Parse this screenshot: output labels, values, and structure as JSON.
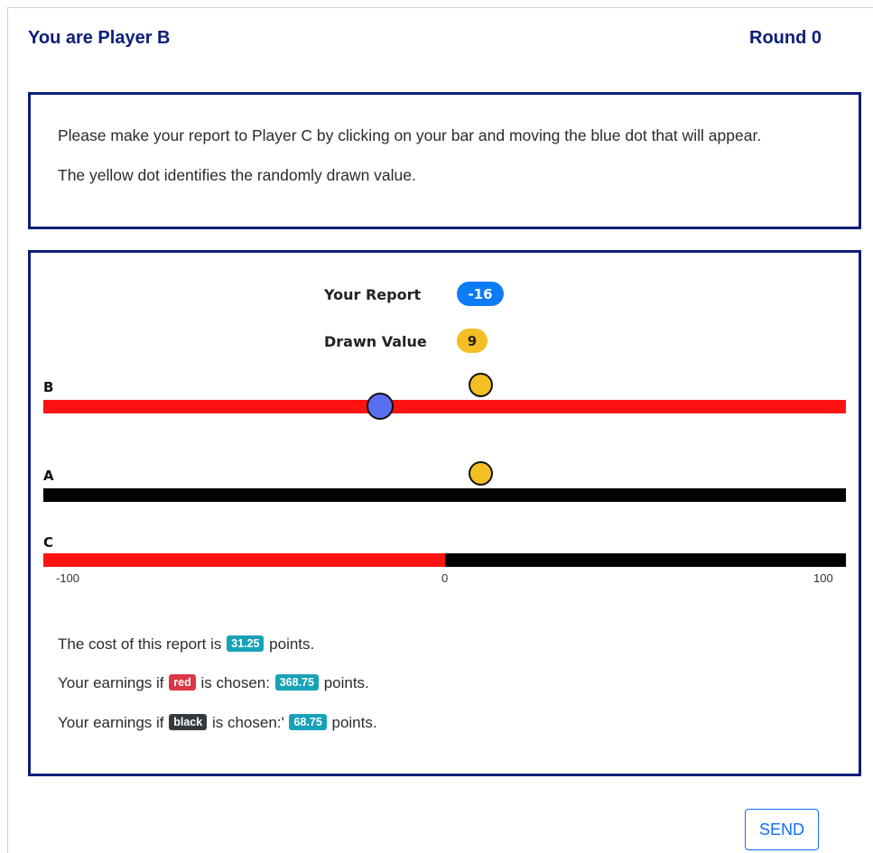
{
  "header": {
    "player": "You are Player B",
    "round": "Round 0"
  },
  "instructions": {
    "line1": "Please make your report to Player C by clicking on your bar and moving the blue dot that will appear.",
    "line2": "The yellow dot identifies the randomly drawn value."
  },
  "report": {
    "label": "Your Report",
    "value": "-16"
  },
  "drawn": {
    "label": "Drawn Value",
    "value": "9"
  },
  "bars": {
    "b_label": "B",
    "a_label": "A",
    "c_label": "C",
    "scale_min": -100,
    "scale_max": 100,
    "report_value": -16,
    "drawn_value": 9,
    "c_split_value": 0,
    "ticks": [
      "-100",
      "0",
      "100"
    ]
  },
  "colors": {
    "red": "#ff1212",
    "black": "#000000",
    "report_dot": "#5a6ff0",
    "drawn_dot": "#f4bf24"
  },
  "earnings": {
    "cost_prefix": "The cost of this report is",
    "cost_value": "31.25",
    "cost_suffix": "points.",
    "red_prefix": "Your earnings if",
    "red_tag": "red",
    "red_middle": "is chosen:",
    "red_value": "368.75",
    "red_suffix": "points.",
    "black_prefix": "Your earnings if",
    "black_tag": "black",
    "black_middle": "is chosen:'",
    "black_value": "68.75",
    "black_suffix": "points."
  },
  "send_button": "SEND"
}
